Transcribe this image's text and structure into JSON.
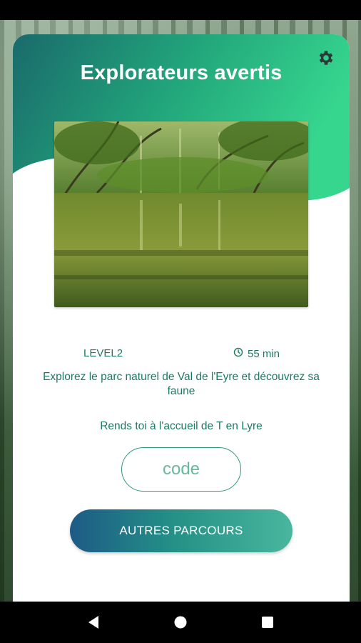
{
  "app": {
    "title": "Explorateurs avertis"
  },
  "card": {
    "level": "LEVEL2",
    "duration": "55 min",
    "description": "Explorez le parc naturel de Val de l'Eyre et découvrez sa faune",
    "instruction": "Rends toi à l'accueil de T en Lyre",
    "code_placeholder": "code",
    "code_value": "",
    "button_label": "AUTRES PARCOURS"
  },
  "icons": {
    "settings": "gear-icon",
    "duration": "clock-icon",
    "nav_back": "triangle-back-icon",
    "nav_home": "circle-home-icon",
    "nav_recents": "square-recents-icon"
  },
  "colors": {
    "accent": "#1c7a64",
    "header_gradient_start": "#1e6e6a",
    "header_gradient_end": "#2fd08a",
    "button_gradient_start": "#1e5a86",
    "button_gradient_end": "#49b79e"
  }
}
